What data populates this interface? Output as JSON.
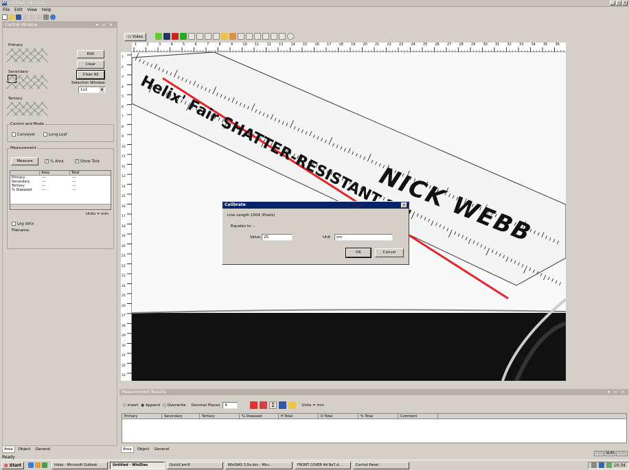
{
  "window": {
    "title": "Untitled - WinDias",
    "app_icon": "AT"
  },
  "menu": [
    "File",
    "Edit",
    "View",
    "Help"
  ],
  "control_window": {
    "title": "Control Window",
    "primary_label": "Primary",
    "secondary_label": "Secondary",
    "tertiary_label": "Tertiary",
    "edit_button": "Edit",
    "clear_button": "Clear",
    "clear_all_button": "Clear All",
    "selection_window_label": "Selection Window",
    "selection_window_value": "1x1",
    "control_mode_label": "Control and Mode",
    "conveyer_label": "Conveyer",
    "long_leaf_label": "Long Leaf",
    "measurement_label": "Measurement",
    "measure_button": "Measure",
    "pct_area_label": "% Area",
    "show_total_label": "Show Tota",
    "table_headers": [
      "",
      "Area",
      "Total"
    ],
    "table_rows": [
      [
        "Primary",
        "---",
        "---"
      ],
      [
        "Secondary",
        "---",
        "---"
      ],
      [
        "Tertiary",
        "---",
        "---"
      ],
      [
        "% Diseased",
        "---",
        "---"
      ]
    ],
    "units_text": "Units = mm",
    "log_data_label": "Log data",
    "filename_label": "Filename:"
  },
  "video_tab": "Video",
  "ruler_top": [
    "1",
    "2",
    "3",
    "4",
    "5",
    "6",
    "7",
    "8",
    "9",
    "10",
    "11",
    "12",
    "13",
    "14",
    "15",
    "16",
    "17",
    "18",
    "19",
    "20",
    "21",
    "22",
    "23",
    "24",
    "25",
    "26",
    "27",
    "28",
    "29",
    "30",
    "31",
    "32",
    "33",
    "34",
    "35",
    "36"
  ],
  "ruler_left": [
    "1",
    "2",
    "3",
    "4",
    "5",
    "6",
    "7",
    "8",
    "9",
    "10",
    "11",
    "12",
    "13",
    "14",
    "15",
    "16",
    "17",
    "18",
    "19",
    "20",
    "21",
    "22",
    "23",
    "24",
    "25",
    "26",
    "27",
    "28",
    "29",
    "30",
    "31",
    "32",
    "33"
  ],
  "ruler_image": {
    "brand_text": "Helix' Fair SHATTER-RESISTANT 12\"",
    "handwriting": "NICK WEBB"
  },
  "calibrate": {
    "title": "Calibrate",
    "line_length": "Line Length 1504 (Pixels)",
    "equates": "Equates to :-",
    "value_label": "Value",
    "value": "25",
    "unit_label": "Unit",
    "unit": "cm",
    "ok": "OK",
    "cancel": "Cancel"
  },
  "measurement_results": {
    "title": "Measurement Results",
    "insert_label": "Insert",
    "append_label": "Append",
    "overwrite_label": "Overwrite",
    "decimal_places_label": "Decimal Places",
    "decimal_places": "4",
    "units_text": "Units = mm",
    "columns": [
      "Primary",
      "Secondary",
      "Tertiary",
      "% Diseased",
      "H Total",
      "D Total",
      "% Total",
      "Comment"
    ]
  },
  "bottom_tabs": [
    "Area",
    "Object",
    "General"
  ],
  "status": "Ready",
  "status_indicators": [
    "CAP",
    "NUM",
    "SCRL"
  ],
  "taskbar": {
    "start": "Start",
    "tasks": [
      "Inbox - Microsoft Outlook",
      "Untitled - WinDias",
      "QuickCam®",
      "WinDIAS 3.0a.doc - Micr...",
      "FRONT COVER A4 No7.d...",
      "Control Panel"
    ],
    "clock": "10:34"
  },
  "colors": {
    "accent": "#0a246a",
    "calibration_line": "#e8222a"
  }
}
